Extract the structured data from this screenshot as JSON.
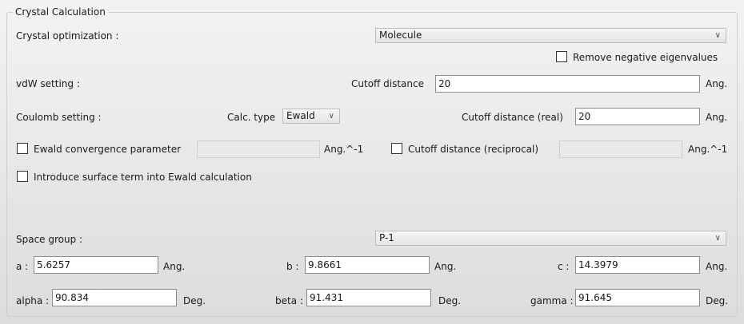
{
  "group": {
    "title": "Crystal Calculation"
  },
  "crystal_opt": {
    "label": "Crystal optimization :",
    "value": "Molecule"
  },
  "remove_neg": {
    "label": "Remove negative eigenvalues",
    "checked": false
  },
  "vdw": {
    "label": "vdW setting :",
    "cutoff_label": "Cutoff distance",
    "cutoff_value": "20",
    "unit": "Ang."
  },
  "coulomb": {
    "label": "Coulomb setting :",
    "calc_type_label": "Calc. type",
    "calc_type_value": "Ewald",
    "cutoff_real_label": "Cutoff distance (real)",
    "cutoff_real_value": "20",
    "unit": "Ang."
  },
  "ewald": {
    "conv_label": "Ewald convergence parameter",
    "conv_value": "",
    "conv_unit": "Ang.^-1",
    "recip_label": "Cutoff distance (reciprocal)",
    "recip_value": "",
    "recip_unit": "Ang.^-1"
  },
  "surface": {
    "label": "Introduce surface term into Ewald calculation"
  },
  "space_group": {
    "label": "Space group :",
    "value": "P-1"
  },
  "cell": {
    "a_label": "a :",
    "a_value": "5.6257",
    "a_unit": "Ang.",
    "b_label": "b :",
    "b_value": "9.8661",
    "b_unit": "Ang.",
    "c_label": "c :",
    "c_value": "14.3979",
    "c_unit": "Ang.",
    "alpha_label": "alpha :",
    "alpha_value": "90.834",
    "alpha_unit": "Deg.",
    "beta_label": "beta :",
    "beta_value": "91.431",
    "beta_unit": "Deg.",
    "gamma_label": "gamma :",
    "gamma_value": "91.645",
    "gamma_unit": "Deg."
  },
  "icons": {
    "dropdown": "chevron-down-icon",
    "checkbox": "checkbox-unchecked-icon"
  }
}
